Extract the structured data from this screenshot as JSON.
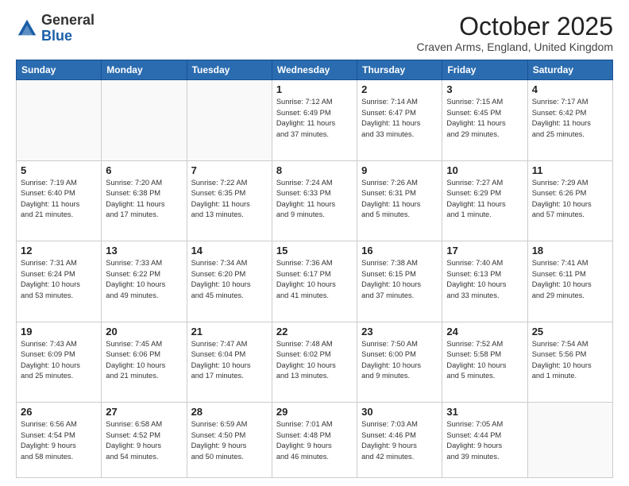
{
  "header": {
    "logo_general": "General",
    "logo_blue": "Blue",
    "month_title": "October 2025",
    "location": "Craven Arms, England, United Kingdom"
  },
  "days_of_week": [
    "Sunday",
    "Monday",
    "Tuesday",
    "Wednesday",
    "Thursday",
    "Friday",
    "Saturday"
  ],
  "weeks": [
    [
      {
        "day": "",
        "info": ""
      },
      {
        "day": "",
        "info": ""
      },
      {
        "day": "",
        "info": ""
      },
      {
        "day": "1",
        "info": "Sunrise: 7:12 AM\nSunset: 6:49 PM\nDaylight: 11 hours\nand 37 minutes."
      },
      {
        "day": "2",
        "info": "Sunrise: 7:14 AM\nSunset: 6:47 PM\nDaylight: 11 hours\nand 33 minutes."
      },
      {
        "day": "3",
        "info": "Sunrise: 7:15 AM\nSunset: 6:45 PM\nDaylight: 11 hours\nand 29 minutes."
      },
      {
        "day": "4",
        "info": "Sunrise: 7:17 AM\nSunset: 6:42 PM\nDaylight: 11 hours\nand 25 minutes."
      }
    ],
    [
      {
        "day": "5",
        "info": "Sunrise: 7:19 AM\nSunset: 6:40 PM\nDaylight: 11 hours\nand 21 minutes."
      },
      {
        "day": "6",
        "info": "Sunrise: 7:20 AM\nSunset: 6:38 PM\nDaylight: 11 hours\nand 17 minutes."
      },
      {
        "day": "7",
        "info": "Sunrise: 7:22 AM\nSunset: 6:35 PM\nDaylight: 11 hours\nand 13 minutes."
      },
      {
        "day": "8",
        "info": "Sunrise: 7:24 AM\nSunset: 6:33 PM\nDaylight: 11 hours\nand 9 minutes."
      },
      {
        "day": "9",
        "info": "Sunrise: 7:26 AM\nSunset: 6:31 PM\nDaylight: 11 hours\nand 5 minutes."
      },
      {
        "day": "10",
        "info": "Sunrise: 7:27 AM\nSunset: 6:29 PM\nDaylight: 11 hours\nand 1 minute."
      },
      {
        "day": "11",
        "info": "Sunrise: 7:29 AM\nSunset: 6:26 PM\nDaylight: 10 hours\nand 57 minutes."
      }
    ],
    [
      {
        "day": "12",
        "info": "Sunrise: 7:31 AM\nSunset: 6:24 PM\nDaylight: 10 hours\nand 53 minutes."
      },
      {
        "day": "13",
        "info": "Sunrise: 7:33 AM\nSunset: 6:22 PM\nDaylight: 10 hours\nand 49 minutes."
      },
      {
        "day": "14",
        "info": "Sunrise: 7:34 AM\nSunset: 6:20 PM\nDaylight: 10 hours\nand 45 minutes."
      },
      {
        "day": "15",
        "info": "Sunrise: 7:36 AM\nSunset: 6:17 PM\nDaylight: 10 hours\nand 41 minutes."
      },
      {
        "day": "16",
        "info": "Sunrise: 7:38 AM\nSunset: 6:15 PM\nDaylight: 10 hours\nand 37 minutes."
      },
      {
        "day": "17",
        "info": "Sunrise: 7:40 AM\nSunset: 6:13 PM\nDaylight: 10 hours\nand 33 minutes."
      },
      {
        "day": "18",
        "info": "Sunrise: 7:41 AM\nSunset: 6:11 PM\nDaylight: 10 hours\nand 29 minutes."
      }
    ],
    [
      {
        "day": "19",
        "info": "Sunrise: 7:43 AM\nSunset: 6:09 PM\nDaylight: 10 hours\nand 25 minutes."
      },
      {
        "day": "20",
        "info": "Sunrise: 7:45 AM\nSunset: 6:06 PM\nDaylight: 10 hours\nand 21 minutes."
      },
      {
        "day": "21",
        "info": "Sunrise: 7:47 AM\nSunset: 6:04 PM\nDaylight: 10 hours\nand 17 minutes."
      },
      {
        "day": "22",
        "info": "Sunrise: 7:48 AM\nSunset: 6:02 PM\nDaylight: 10 hours\nand 13 minutes."
      },
      {
        "day": "23",
        "info": "Sunrise: 7:50 AM\nSunset: 6:00 PM\nDaylight: 10 hours\nand 9 minutes."
      },
      {
        "day": "24",
        "info": "Sunrise: 7:52 AM\nSunset: 5:58 PM\nDaylight: 10 hours\nand 5 minutes."
      },
      {
        "day": "25",
        "info": "Sunrise: 7:54 AM\nSunset: 5:56 PM\nDaylight: 10 hours\nand 1 minute."
      }
    ],
    [
      {
        "day": "26",
        "info": "Sunrise: 6:56 AM\nSunset: 4:54 PM\nDaylight: 9 hours\nand 58 minutes."
      },
      {
        "day": "27",
        "info": "Sunrise: 6:58 AM\nSunset: 4:52 PM\nDaylight: 9 hours\nand 54 minutes."
      },
      {
        "day": "28",
        "info": "Sunrise: 6:59 AM\nSunset: 4:50 PM\nDaylight: 9 hours\nand 50 minutes."
      },
      {
        "day": "29",
        "info": "Sunrise: 7:01 AM\nSunset: 4:48 PM\nDaylight: 9 hours\nand 46 minutes."
      },
      {
        "day": "30",
        "info": "Sunrise: 7:03 AM\nSunset: 4:46 PM\nDaylight: 9 hours\nand 42 minutes."
      },
      {
        "day": "31",
        "info": "Sunrise: 7:05 AM\nSunset: 4:44 PM\nDaylight: 9 hours\nand 39 minutes."
      },
      {
        "day": "",
        "info": ""
      }
    ]
  ]
}
